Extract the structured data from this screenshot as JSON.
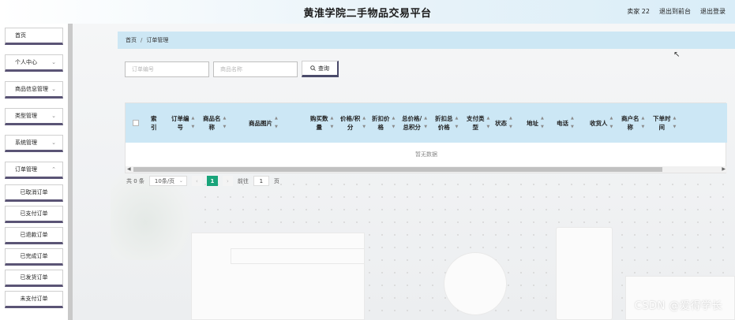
{
  "header": {
    "title": "黄淮学院二手物品交易平台",
    "user_label": "卖家 22",
    "back_front_label": "退出到前台",
    "logout_label": "退出登录"
  },
  "sidebar": {
    "items": [
      {
        "label": "首页",
        "has_chevron": false
      },
      {
        "label": "个人中心",
        "has_chevron": true
      },
      {
        "label": "商品信息管理",
        "has_chevron": true
      },
      {
        "label": "类型管理",
        "has_chevron": true
      },
      {
        "label": "系统管理",
        "has_chevron": true
      },
      {
        "label": "订单管理",
        "has_chevron": true
      }
    ],
    "sub_items": [
      {
        "label": "已取消订单"
      },
      {
        "label": "已支付订单"
      },
      {
        "label": "已退款订单"
      },
      {
        "label": "已完成订单"
      },
      {
        "label": "已发货订单"
      },
      {
        "label": "未支付订单"
      }
    ]
  },
  "breadcrumb": {
    "home": "首页",
    "separator": "/",
    "current": "订单管理"
  },
  "search": {
    "order_no_placeholder": "订单编号",
    "product_name_placeholder": "商品名称",
    "query_label": "查询"
  },
  "table": {
    "columns": [
      {
        "label": "索\n引"
      },
      {
        "label": "订单编\n号"
      },
      {
        "label": "商品名\n称"
      },
      {
        "label": "商品图片"
      },
      {
        "label": "购买数\n量"
      },
      {
        "label": "价格/积\n分"
      },
      {
        "label": "折扣价\n格"
      },
      {
        "label": "总价格/\n总积分"
      },
      {
        "label": "折扣总\n价格"
      },
      {
        "label": "支付类\n型"
      },
      {
        "label": "状态"
      },
      {
        "label": "地址"
      },
      {
        "label": "电话"
      },
      {
        "label": "收货人"
      },
      {
        "label": "商户名\n称"
      },
      {
        "label": "下单时\n间"
      }
    ],
    "empty_text": "暂无数据"
  },
  "pagination": {
    "total_label": "共 0 条",
    "page_size": "10条/页",
    "current_page": "1",
    "goto_prefix": "前往",
    "goto_value": "1",
    "goto_suffix": "页"
  },
  "watermark": "CSDN @爱得学长",
  "colors": {
    "breadcrumb_bg": "#cde7f4",
    "table_header_bg": "#cce7f5",
    "active_page": "#19a47a",
    "menu_accent": "#5a5475"
  }
}
